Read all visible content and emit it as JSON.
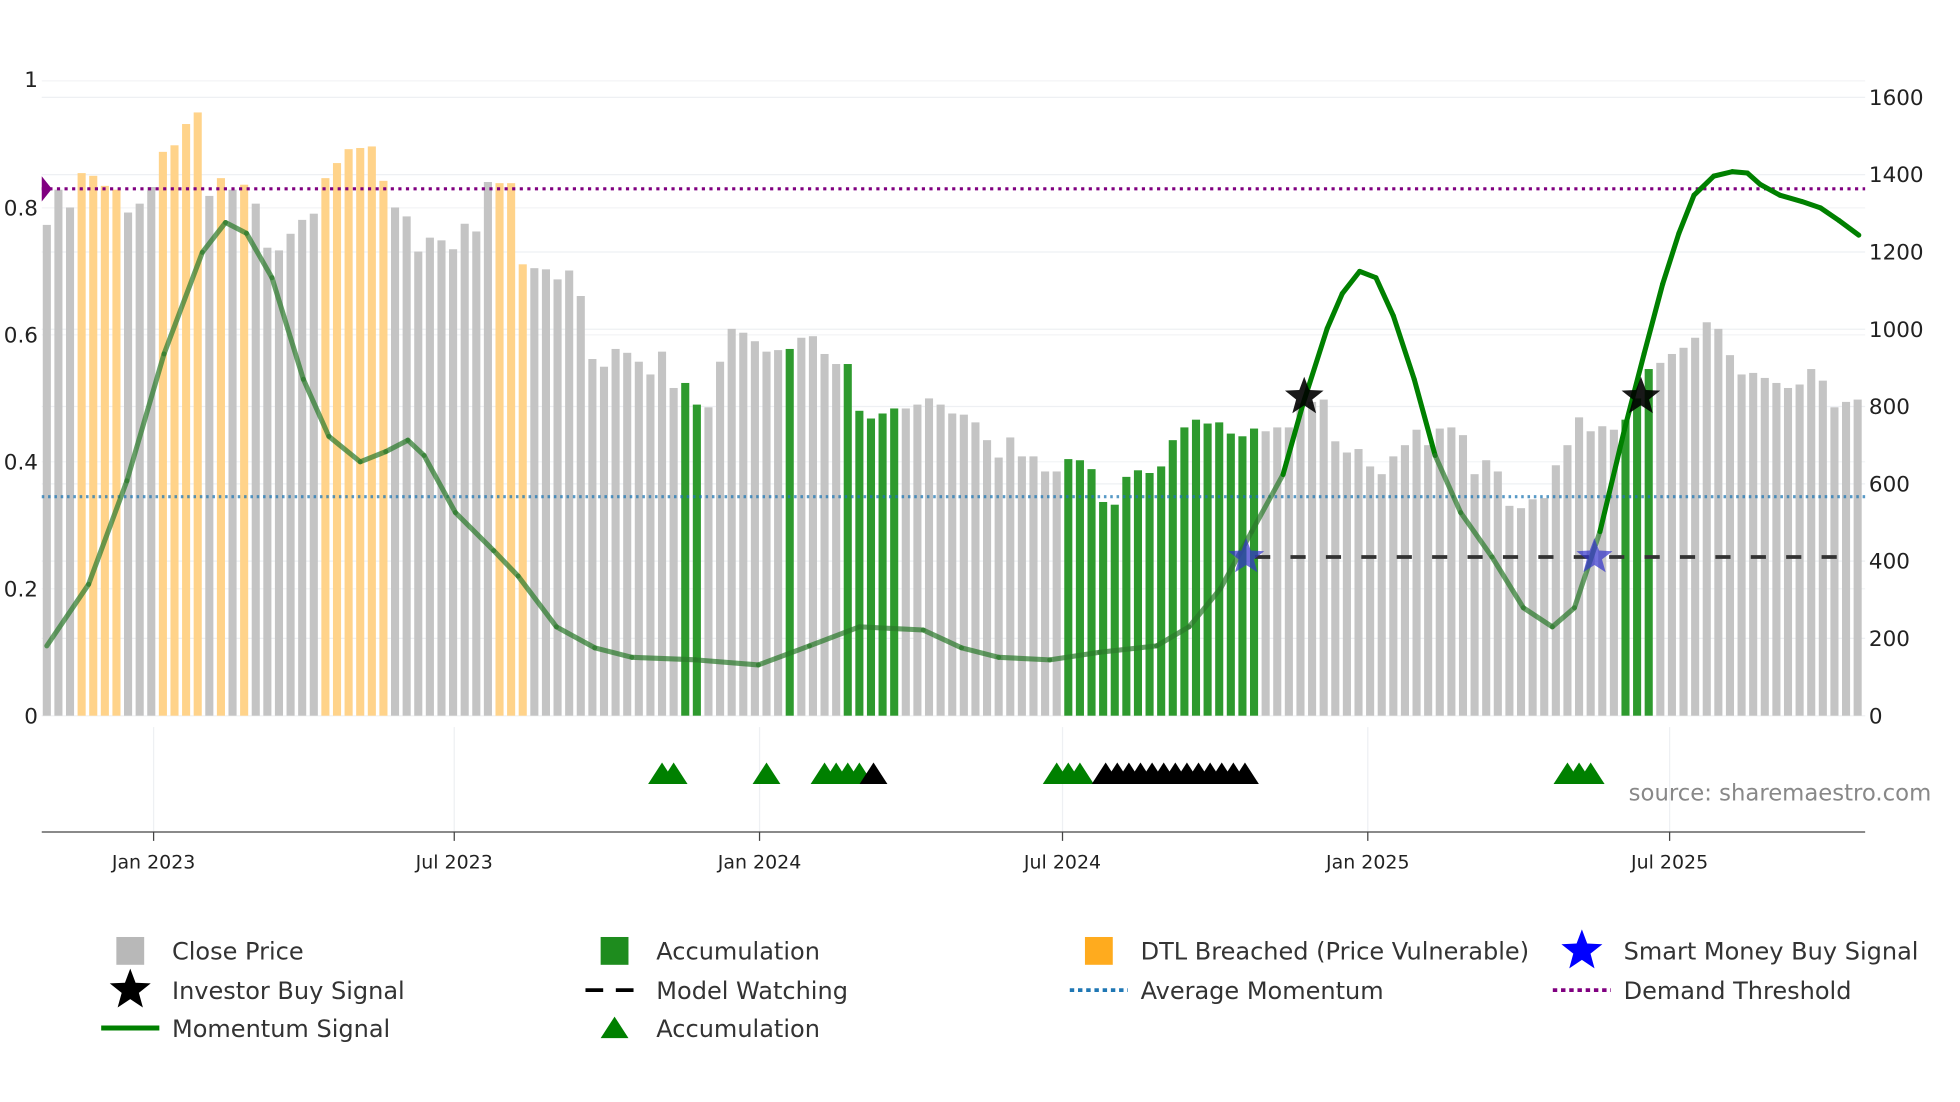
{
  "chart_data": {
    "type": "bar",
    "title": "",
    "left_axis": {
      "ylim": [
        0,
        1
      ],
      "ticks": [
        "0",
        "0.2",
        "0.4",
        "0.6",
        "0.8",
        "1"
      ]
    },
    "right_axis": {
      "ylim": [
        0,
        1600
      ],
      "ticks": [
        "0",
        "200",
        "400",
        "600",
        "800",
        "1000",
        "1200",
        "1400",
        "1600"
      ]
    },
    "x_ticks": [
      {
        "label": "Jan 2023",
        "bar_index": 9.2
      },
      {
        "label": "Jul 2023",
        "bar_index": 35.1
      },
      {
        "label": "Jan 2024",
        "bar_index": 61.4
      },
      {
        "label": "Jul 2024",
        "bar_index": 87.5
      },
      {
        "label": "Jan 2025",
        "bar_index": 113.8
      },
      {
        "label": "Jul 2025",
        "bar_index": 139.8
      }
    ],
    "close_price": [
      1270,
      1361,
      1315,
      1404,
      1397,
      1371,
      1361,
      1302,
      1325,
      1368,
      1459,
      1476,
      1531,
      1561,
      1345,
      1391,
      1361,
      1374,
      1325,
      1211,
      1204,
      1247,
      1283,
      1299,
      1391,
      1430,
      1466,
      1469,
      1473,
      1384,
      1315,
      1292,
      1201,
      1237,
      1230,
      1207,
      1273,
      1253,
      1381,
      1378,
      1378,
      1168,
      1158,
      1155,
      1129,
      1152,
      1086,
      923,
      903,
      949,
      939,
      916,
      883,
      942,
      848,
      861,
      805,
      798,
      916,
      1001,
      991,
      969,
      942,
      946,
      949,
      978,
      982,
      936,
      910,
      910,
      789,
      769,
      782,
      795,
      795,
      805,
      821,
      805,
      782,
      779,
      759,
      713,
      668,
      720,
      671,
      671,
      632,
      632,
      664,
      661,
      638,
      553,
      546,
      618,
      635,
      628,
      645,
      713,
      746,
      766,
      756,
      759,
      730,
      723,
      743,
      736,
      746,
      746,
      808,
      812,
      818,
      710,
      681,
      690,
      645,
      625,
      671,
      700,
      740,
      700,
      743,
      746,
      726,
      625,
      661,
      632,
      543,
      537,
      560,
      563,
      648,
      700,
      772,
      736,
      749,
      740,
      766,
      821,
      897,
      913,
      936,
      952,
      978,
      1018,
      1001,
      933,
      883,
      887,
      874,
      861,
      848,
      857,
      897,
      867,
      798,
      812,
      818
    ],
    "bar_state": "gggoooogggoooogogoggggggoooooogggggggggooogggggggggggggaagggggggaggggaaaaaggggggggggggggaaaaaaaaaaaaaaaaagggggggggggggggggggggggggggggggaaaggggggggggggggggggggggg",
    "momentum_signal": {
      "points": [
        [
          0,
          0.11
        ],
        [
          3.6,
          0.207
        ],
        [
          6.9,
          0.37
        ],
        [
          10.1,
          0.57
        ],
        [
          13.4,
          0.73
        ],
        [
          15.4,
          0.777
        ],
        [
          17.2,
          0.76
        ],
        [
          19.4,
          0.69
        ],
        [
          22.1,
          0.53
        ],
        [
          24.3,
          0.44
        ],
        [
          27,
          0.4
        ],
        [
          29.2,
          0.416
        ],
        [
          31.1,
          0.434
        ],
        [
          32.5,
          0.41
        ],
        [
          35.2,
          0.32
        ],
        [
          38.5,
          0.26
        ],
        [
          40.6,
          0.22
        ],
        [
          43.9,
          0.14
        ],
        [
          47.2,
          0.107
        ],
        [
          50.4,
          0.092
        ],
        [
          55.9,
          0.088
        ],
        [
          61.3,
          0.08
        ],
        [
          65.7,
          0.11
        ],
        [
          70,
          0.14
        ],
        [
          75.5,
          0.135
        ],
        [
          78.8,
          0.107
        ],
        [
          82,
          0.092
        ],
        [
          86.4,
          0.088
        ],
        [
          90.7,
          0.1
        ],
        [
          95.6,
          0.11
        ],
        [
          98.4,
          0.14
        ],
        [
          101.1,
          0.2
        ],
        [
          103.8,
          0.29
        ],
        [
          106.5,
          0.38
        ],
        [
          108.2,
          0.49
        ],
        [
          110.3,
          0.61
        ],
        [
          111.6,
          0.665
        ],
        [
          113.1,
          0.7
        ],
        [
          114.5,
          0.69
        ],
        [
          116,
          0.63
        ],
        [
          117.8,
          0.53
        ],
        [
          119.6,
          0.41
        ],
        [
          121.8,
          0.32
        ],
        [
          124.5,
          0.25
        ],
        [
          127.2,
          0.17
        ],
        [
          129.7,
          0.14
        ],
        [
          131.6,
          0.17
        ],
        [
          133.8,
          0.29
        ],
        [
          135.9,
          0.45
        ],
        [
          137.6,
          0.57
        ],
        [
          139.2,
          0.68
        ],
        [
          140.6,
          0.76
        ],
        [
          141.9,
          0.82
        ],
        [
          143.6,
          0.85
        ],
        [
          145.2,
          0.857
        ],
        [
          146.5,
          0.855
        ],
        [
          147.6,
          0.837
        ],
        [
          149.3,
          0.82
        ],
        [
          151.2,
          0.81
        ],
        [
          152.8,
          0.8
        ],
        [
          154.4,
          0.78
        ],
        [
          156.1,
          0.757
        ]
      ]
    },
    "average_momentum": 0.345,
    "demand_threshold": 0.83,
    "model_watching": {
      "value": 0.25,
      "from_index": 103,
      "to_index": 155
    },
    "investor_buy_signals": [
      {
        "index": 108,
        "price": 825
      },
      {
        "index": 137,
        "price": 825
      }
    ],
    "smart_money_buy_signals": [
      {
        "index": 103,
        "momentum": 0.25
      },
      {
        "index": 133,
        "momentum": 0.25
      }
    ],
    "accumulation_markers": {
      "green": [
        53,
        54,
        62,
        67,
        68,
        69,
        70,
        87,
        88,
        89,
        131,
        132,
        133
      ],
      "black": [
        71,
        91,
        92,
        93,
        94,
        95,
        96,
        97,
        98,
        99,
        100,
        101,
        102,
        103
      ]
    },
    "legend": [
      {
        "label": "Close Price",
        "symbol": "square",
        "color": "#b8b8b8"
      },
      {
        "label": "Accumulation",
        "symbol": "square",
        "color": "#1e8c1e"
      },
      {
        "label": "DTL Breached (Price Vulnerable)",
        "symbol": "square",
        "color": "#ffab1e"
      },
      {
        "label": "Smart Money Buy Signal",
        "symbol": "star",
        "color": "#0000ff"
      },
      {
        "label": "Investor Buy Signal",
        "symbol": "star",
        "color": "#000000"
      },
      {
        "label": "Model Watching",
        "symbol": "dash",
        "color": "#000000"
      },
      {
        "label": "Average Momentum",
        "symbol": "dot",
        "color": "#1f77b4"
      },
      {
        "label": "Demand Threshold",
        "symbol": "dot",
        "color": "#800080"
      },
      {
        "label": "Momentum Signal",
        "symbol": "line",
        "color": "#008000"
      },
      {
        "label": "Accumulation",
        "symbol": "triangle",
        "color": "#008000"
      }
    ],
    "legend_position": "bottom",
    "source": "source: sharemaestro.com"
  }
}
